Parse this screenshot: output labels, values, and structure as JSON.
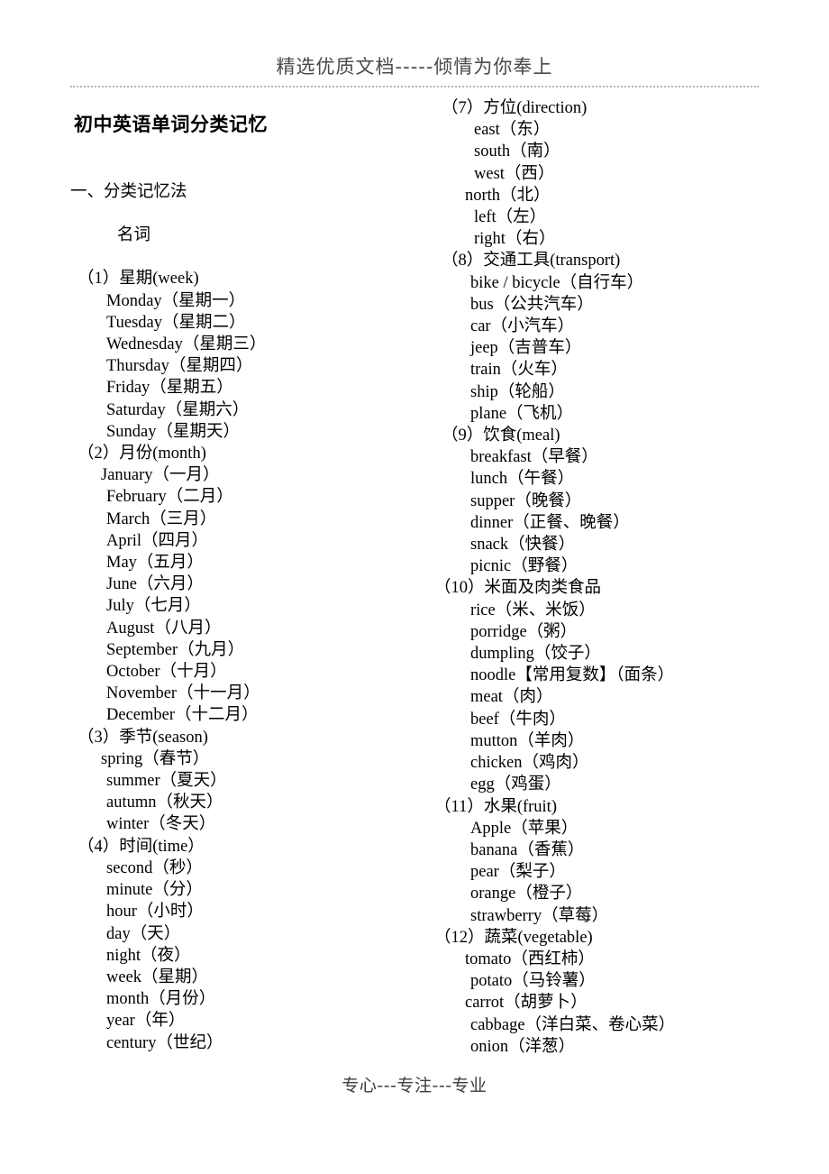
{
  "header": {
    "watermark": "精选优质文档-----倾情为你奉上"
  },
  "footer": {
    "watermark": "专心---专注---专业"
  },
  "title": "初中英语单词分类记忆",
  "section": {
    "heading": "一、分类记忆法",
    "subheading": "名词"
  },
  "groups": [
    {
      "id": "week",
      "heading": "（1）星期(week)",
      "items": [
        "Monday（星期一）",
        "Tuesday（星期二）",
        "Wednesday（星期三）",
        "Thursday（星期四）",
        "Friday（星期五）",
        "Saturday（星期六）",
        "Sunday（星期天）"
      ]
    },
    {
      "id": "month",
      "heading": "（2）月份(month)",
      "items": [
        "January（一月）",
        "February（二月）",
        "March（三月）",
        "April（四月）",
        "May（五月）",
        "June（六月）",
        "July（七月）",
        "August（八月）",
        "September（九月）",
        "October（十月）",
        "November（十一月）",
        "December（十二月）"
      ]
    },
    {
      "id": "season",
      "heading": "（3）季节(season)",
      "items": [
        "spring（春节）",
        "summer（夏天）",
        "autumn（秋天）",
        "winter（冬天）"
      ]
    },
    {
      "id": "time",
      "heading": "（4）时间(time）",
      "items": [
        "second（秒）",
        "minute（分）",
        "hour（小时）",
        "day（天）",
        "night（夜）",
        "week（星期）",
        "month（月份）",
        "year（年）",
        "century（世纪）"
      ]
    },
    {
      "id": "direction",
      "heading": "（7）方位(direction)",
      "items": [
        "east（东）",
        "south（南）",
        "west（西）",
        "north（北）",
        "left（左）",
        "right（右）"
      ]
    },
    {
      "id": "transport",
      "heading": "（8）交通工具(transport)",
      "items": [
        "bike / bicycle（自行车）",
        "bus（公共汽车）",
        "car（小汽车）",
        "jeep（吉普车）",
        "train（火车）",
        "ship（轮船）",
        "plane（飞机）"
      ]
    },
    {
      "id": "meal",
      "heading": "（9）饮食(meal)",
      "items": [
        "breakfast（早餐）",
        "lunch（午餐）",
        "supper（晚餐）",
        "dinner（正餐、晚餐）",
        "snack（快餐）",
        "picnic（野餐）"
      ]
    },
    {
      "id": "staple-meat",
      "heading": "（10）米面及肉类食品",
      "items": [
        "rice（米、米饭）",
        "porridge（粥）",
        "dumpling（饺子）",
        "noodle【常用复数】（面条）",
        "meat（肉）",
        "beef（牛肉）",
        "mutton（羊肉）",
        "chicken（鸡肉）",
        "egg（鸡蛋）"
      ]
    },
    {
      "id": "fruit",
      "heading": "（11）水果(fruit)",
      "items": [
        "Apple（苹果）",
        "banana（香蕉）",
        "pear（梨子）",
        "orange（橙子）",
        "strawberry（草莓）"
      ]
    },
    {
      "id": "vegetable",
      "heading": "（12）蔬菜(vegetable)",
      "items": [
        "tomato（西红柿）",
        "potato（马铃薯）",
        "carrot（胡萝卜）",
        "cabbage（洋白菜、卷心菜）",
        "onion（洋葱）"
      ]
    }
  ]
}
